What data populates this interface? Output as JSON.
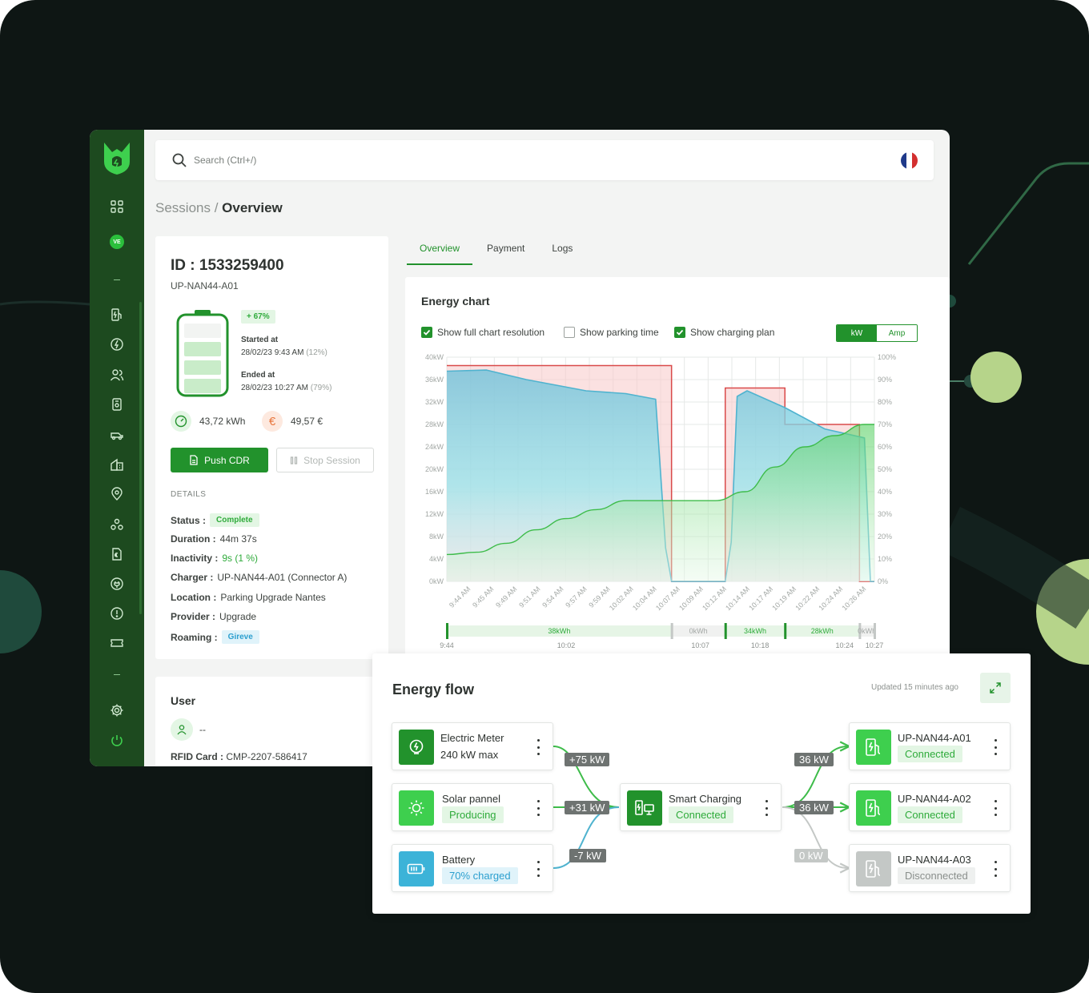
{
  "search": {
    "placeholder": "Search (Ctrl+/)"
  },
  "sidebar": {
    "user_badge": "VE"
  },
  "breadcrumb": {
    "parent": "Sessions",
    "separator": " / ",
    "current": "Overview"
  },
  "session": {
    "id": "ID : 1533259400",
    "charger_code": "UP-NAN44-A01",
    "charge_gain": "+ 67%",
    "battery_fill": 0.67,
    "started_label": "Started at",
    "started_value": "28/02/23 9:43 AM",
    "started_pct": "(12%)",
    "ended_label": "Ended at",
    "ended_value": "28/02/23 10:27 AM",
    "ended_pct": "(79%)",
    "energy": "43,72 kWh",
    "cost": "49,57 €",
    "push_cdr": "Push CDR",
    "stop_session": "Stop Session",
    "details_heading": "DETAILS",
    "details": {
      "status_label": "Status :",
      "status_value": "Complete",
      "duration_label": "Duration :",
      "duration_value": "44m 37s",
      "inactivity_label": "Inactivity :",
      "inactivity_value": "9s (1 %)",
      "charger_label": "Charger :",
      "charger_value": "UP-NAN44-A01 (Connector A)",
      "location_label": "Location :",
      "location_value": "Parking Upgrade Nantes",
      "provider_label": "Provider :",
      "provider_value": "Upgrade",
      "roaming_label": "Roaming :",
      "roaming_value": "Gireve"
    }
  },
  "user": {
    "heading": "User",
    "name": "--",
    "rfid_label": "RFID Card :",
    "rfid_value": "CMP-2207-586417"
  },
  "tabs": [
    {
      "label": "Overview"
    },
    {
      "label": "Payment"
    },
    {
      "label": "Logs"
    }
  ],
  "energy_chart": {
    "title": "Energy chart",
    "options": {
      "full_resolution": {
        "label": "Show full chart resolution",
        "checked": true
      },
      "parking_time": {
        "label": "Show parking time",
        "checked": false
      },
      "charging_plan": {
        "label": "Show charging plan",
        "checked": true
      }
    },
    "unit_toggle": {
      "kw": "kW",
      "amp": "Amp",
      "selected": "kW"
    }
  },
  "chart_data": {
    "type": "area",
    "y_left": {
      "ticks": [
        "0kW",
        "4kW",
        "8kW",
        "12kW",
        "16kW",
        "20kW",
        "24kW",
        "28kW",
        "32kW",
        "36kW",
        "40kW"
      ],
      "range": [
        0,
        40
      ]
    },
    "y_right": {
      "ticks": [
        "0%",
        "10%",
        "20%",
        "30%",
        "40%",
        "50%",
        "60%",
        "70%",
        "80%",
        "90%",
        "100%"
      ],
      "range": [
        0,
        100
      ]
    },
    "x_range": [
      0,
      43
    ],
    "x_ticks": [
      "9:44 AM",
      "9:45 AM",
      "9:49 AM",
      "9:51 AM",
      "9:54 AM",
      "9:57 AM",
      "9:59 AM",
      "10:02 AM",
      "10:04 AM",
      "10:07 AM",
      "10:09 AM",
      "10:12 AM",
      "10:14 AM",
      "10:17 AM",
      "10:19 AM",
      "10:22 AM",
      "10:24 AM",
      "10:26 AM"
    ],
    "series": [
      {
        "kind": "power",
        "color": "#4fb3cf",
        "x": [
          0,
          4,
          8,
          14,
          18,
          21,
          22,
          22.6,
          26,
          28,
          28.6,
          29.2,
          30.2,
          34,
          38,
          42,
          42.6,
          43
        ],
        "y": [
          37.5,
          37.7,
          36,
          34,
          33.5,
          32.5,
          6,
          0,
          0,
          0,
          7,
          33,
          34,
          31,
          27.2,
          25.6,
          0,
          0
        ]
      },
      {
        "kind": "soc",
        "color": "#3ebc4a",
        "x": [
          0,
          3,
          6,
          9,
          12,
          15,
          18,
          21,
          24,
          27,
          30,
          33,
          36,
          39,
          42,
          43
        ],
        "y": [
          12,
          13,
          17,
          23,
          28,
          32,
          36,
          36,
          36,
          36,
          40,
          51,
          60,
          65,
          70,
          70
        ]
      },
      {
        "kind": "plan",
        "color": "#d94a4a",
        "x": [
          0,
          22.6,
          22.6,
          28,
          28,
          34,
          34,
          41.5,
          41.5,
          43
        ],
        "y": [
          38.5,
          38.5,
          0,
          0,
          34.5,
          34.5,
          28,
          28,
          0,
          0
        ]
      }
    ],
    "timeline": {
      "segments": [
        {
          "label": "38kWh",
          "start": 0,
          "end": 22.6,
          "state": "charging"
        },
        {
          "label": "0kWh",
          "start": 22.6,
          "end": 28,
          "state": "idle"
        },
        {
          "label": "34kWh",
          "start": 28,
          "end": 34,
          "state": "charging"
        },
        {
          "label": "28kWh",
          "start": 34,
          "end": 41.5,
          "state": "charging"
        },
        {
          "label": "0kWh",
          "start": 41.5,
          "end": 43,
          "state": "idle"
        }
      ],
      "ticks": [
        {
          "label": "9:44",
          "x": 0
        },
        {
          "label": "10:02",
          "x": 12
        },
        {
          "label": "10:07",
          "x": 25.5
        },
        {
          "label": "10:18",
          "x": 31.5
        },
        {
          "label": "10:24",
          "x": 40
        },
        {
          "label": "10:27",
          "x": 43
        }
      ]
    }
  },
  "energy_flow": {
    "title": "Energy flow",
    "updated": "Updated 15 minutes ago",
    "sources": [
      {
        "name": "Electric Meter",
        "sub": "240 kW max"
      },
      {
        "name": "Solar pannel",
        "status": "Producing"
      },
      {
        "name": "Battery",
        "status": "70% charged"
      }
    ],
    "hub": {
      "name": "Smart Charging",
      "status": "Connected"
    },
    "chargers": [
      {
        "name": "UP-NAN44-A01",
        "status": "Connected"
      },
      {
        "name": "UP-NAN44-A02",
        "status": "Connected"
      },
      {
        "name": "UP-NAN44-A03",
        "status": "Disconnected"
      }
    ],
    "flows_in": [
      "+75 kW",
      "+31 kW",
      "-7 kW"
    ],
    "flows_out": [
      "36 kW",
      "36 kW",
      "0 kW"
    ],
    "colors": {
      "green": "#3ebc4a",
      "blue": "#4fb3cf",
      "grey": "#c4c8c6"
    }
  }
}
